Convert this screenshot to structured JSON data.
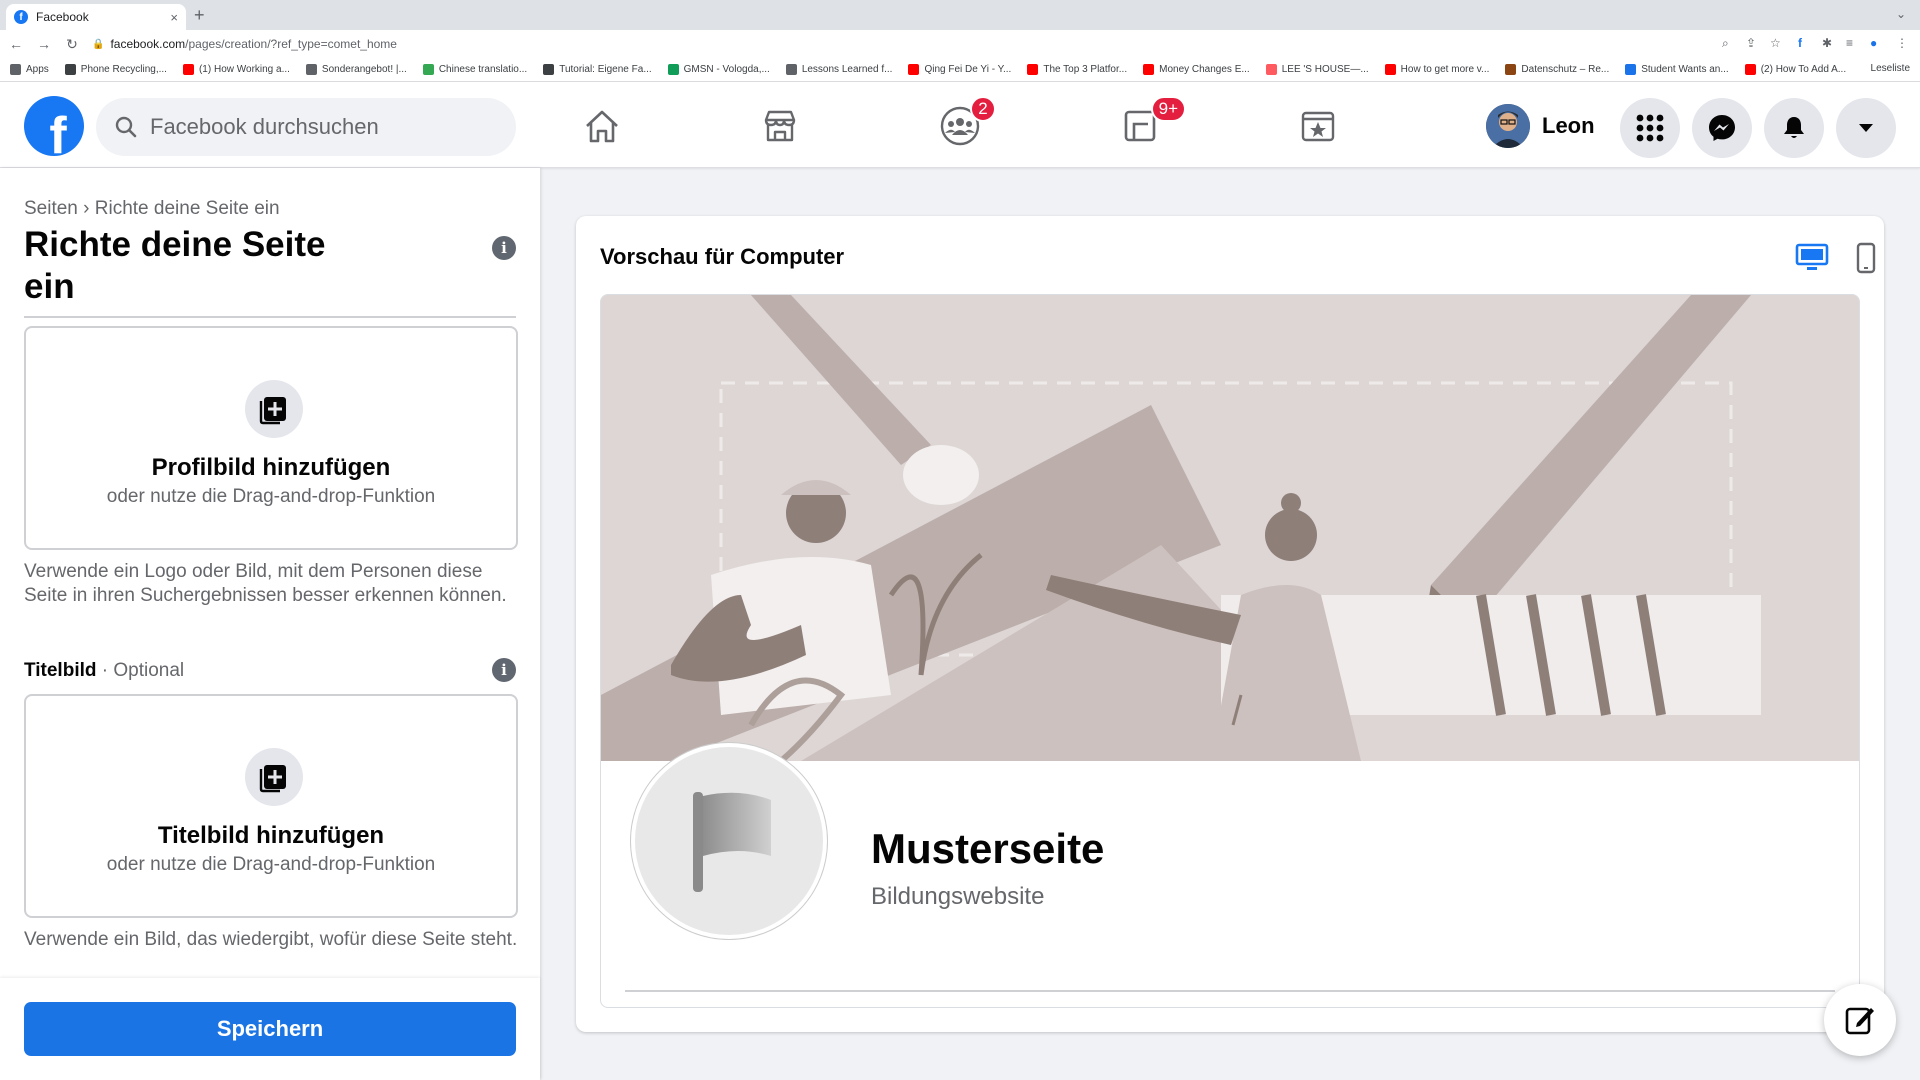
{
  "browser": {
    "tab_title": "Facebook",
    "tab_favicon": "f",
    "tab_close": "×",
    "new_tab": "+",
    "url_host": "facebook.com",
    "url_path": "/pages/creation/?ref_type=comet_home",
    "bookmarks": [
      {
        "label": "Apps",
        "color": "#5f6368"
      },
      {
        "label": "Phone Recycling,...",
        "color": "#3c4043"
      },
      {
        "label": "(1) How Working a...",
        "color": "#ff0000"
      },
      {
        "label": "Sonderangebot! |...",
        "color": "#5f6368"
      },
      {
        "label": "Chinese translatio...",
        "color": "#34a853"
      },
      {
        "label": "Tutorial: Eigene Fa...",
        "color": "#3c4043"
      },
      {
        "label": "GMSN - Vologda,...",
        "color": "#0f9d58"
      },
      {
        "label": "Lessons Learned f...",
        "color": "#5f6368"
      },
      {
        "label": "Qing Fei De Yi - Y...",
        "color": "#ff0000"
      },
      {
        "label": "The Top 3 Platfor...",
        "color": "#ff0000"
      },
      {
        "label": "Money Changes E...",
        "color": "#ff0000"
      },
      {
        "label": "LEE 'S HOUSE—...",
        "color": "#ff5a5f"
      },
      {
        "label": "How to get more v...",
        "color": "#ff0000"
      },
      {
        "label": "Datenschutz – Re...",
        "color": "#8b4513"
      },
      {
        "label": "Student Wants an...",
        "color": "#1a73e8"
      },
      {
        "label": "(2) How To Add A...",
        "color": "#ff0000"
      }
    ],
    "reading_list": "Leseliste"
  },
  "fbnav": {
    "logo": "f",
    "search_placeholder": "Facebook durchsuchen",
    "groups_badge": "2",
    "gaming_badge": "9+",
    "profile_name": "Leon"
  },
  "left": {
    "breadcrumb": "Seiten › Richte deine Seite ein",
    "title": "Richte deine Seite ein",
    "info_glyph": "i",
    "profile_box": {
      "title": "Profilbild hinzufügen",
      "subtitle": "oder nutze die Drag-and-drop-Funktion"
    },
    "profile_help": "Verwende ein Logo oder Bild, mit dem Personen diese Seite in ihren Suchergebnissen besser erkennen können.",
    "cover_label": "Titelbild",
    "cover_optional": " · Optional",
    "cover_box": {
      "title": "Titelbild hinzufügen",
      "subtitle": "oder nutze die Drag-and-drop-Funktion"
    },
    "cover_help": "Verwende ein Bild, das wiedergibt, wofür diese Seite steht.",
    "save_label": "Speichern"
  },
  "preview": {
    "title": "Vorschau für Computer",
    "page_name": "Musterseite",
    "page_category": "Bildungswebsite"
  },
  "colors": {
    "brand": "#1877f2",
    "save_button": "#1b74e4",
    "badge": "#e41e3f",
    "cover_bg": "#ddd6d4"
  }
}
